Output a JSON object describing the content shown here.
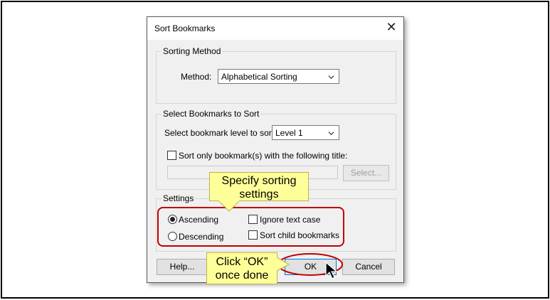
{
  "dialog": {
    "title": "Sort Bookmarks",
    "close_glyph": "✕"
  },
  "sorting_method": {
    "legend": "Sorting Method",
    "method_label": "Method:",
    "method_value": "Alphabetical Sorting"
  },
  "select_bookmarks": {
    "legend": "Select Bookmarks to Sort",
    "level_label": "Select bookmark level to sort:",
    "level_value": "Level 1",
    "title_checkbox_label": "Sort only bookmark(s) with the following title:",
    "title_checkbox_checked": false,
    "title_input_value": "",
    "select_button": "Select..."
  },
  "settings": {
    "legend": "Settings",
    "ascending_label": "Ascending",
    "ascending_selected": true,
    "descending_label": "Descending",
    "descending_selected": false,
    "ignore_case_label": "Ignore text case",
    "ignore_case_checked": false,
    "sort_child_label": "Sort child bookmarks",
    "sort_child_checked": false
  },
  "buttons": {
    "help": "Help...",
    "ok": "OK",
    "cancel": "Cancel"
  },
  "callouts": {
    "sorting_line1": "Specify sorting",
    "sorting_line2": "settings",
    "ok_line1": "Click “OK”",
    "ok_line2": "once done"
  },
  "colors": {
    "highlight_red": "#c00000",
    "callout_fill": "#ffff99",
    "default_button_border": "#0078d7"
  },
  "icons": {
    "close": "close-icon",
    "dropdown": "chevron-down-icon",
    "pointer": "mouse-pointer-icon"
  }
}
